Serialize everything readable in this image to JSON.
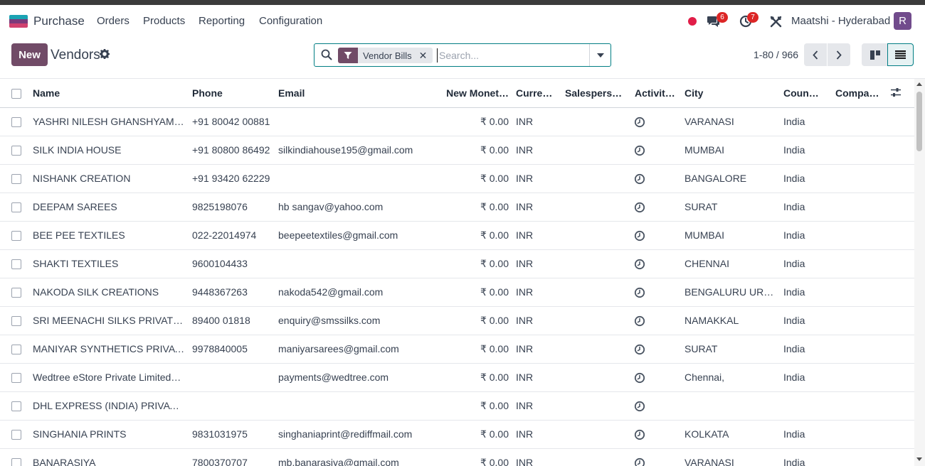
{
  "navbar": {
    "app_name": "Purchase",
    "menu": [
      "Orders",
      "Products",
      "Reporting",
      "Configuration"
    ],
    "messages_count": "6",
    "activities_count": "7",
    "company": "Maatshi - Hyderabad",
    "avatar_letter": "R"
  },
  "control_panel": {
    "new_label": "New",
    "title": "Vendors",
    "facet_label": "Vendor Bills",
    "search_placeholder": "Search...",
    "pager": "1-80 / 966"
  },
  "table": {
    "columns": [
      "Name",
      "Phone",
      "Email",
      "New Monet…",
      "Currency",
      "Salespers…",
      "Activiti…",
      "City",
      "Coun…",
      "Compa…"
    ],
    "rows": [
      {
        "name": "YASHRI NILESH GHANSHYAM SI…",
        "phone": "+91 80042 00881",
        "email": "",
        "amount": "₹ 0.00",
        "currency": "INR",
        "city": "VARANASI",
        "country": "India"
      },
      {
        "name": "SILK INDIA HOUSE",
        "phone": "+91 80800 86492",
        "email": "silkindiahouse195@gmail.com",
        "amount": "₹ 0.00",
        "currency": "INR",
        "city": "MUMBAI",
        "country": "India"
      },
      {
        "name": "NISHANK CREATION",
        "phone": "+91 93420 62229",
        "email": "",
        "amount": "₹ 0.00",
        "currency": "INR",
        "city": "BANGALORE",
        "country": "India"
      },
      {
        "name": "DEEPAM SAREES",
        "phone": "9825198076",
        "email": "hb sangav@yahoo.com",
        "amount": "₹ 0.00",
        "currency": "INR",
        "city": "SURAT",
        "country": "India"
      },
      {
        "name": "BEE PEE TEXTILES",
        "phone": "022-22014974",
        "email": "beepeetextiles@gmail.com",
        "amount": "₹ 0.00",
        "currency": "INR",
        "city": "MUMBAI",
        "country": "India"
      },
      {
        "name": "SHAKTI TEXTILES",
        "phone": "9600104433",
        "email": "",
        "amount": "₹ 0.00",
        "currency": "INR",
        "city": "CHENNAI",
        "country": "India"
      },
      {
        "name": "NAKODA SILK CREATIONS",
        "phone": "9448367263",
        "email": "nakoda542@gmail.com",
        "amount": "₹ 0.00",
        "currency": "INR",
        "city": "BENGALURU URB…",
        "country": "India"
      },
      {
        "name": "SRI MEENACHI SILKS PRIVATE LI…",
        "phone": "89400 01818",
        "email": "enquiry@smssilks.com",
        "amount": "₹ 0.00",
        "currency": "INR",
        "city": "NAMAKKAL",
        "country": "India"
      },
      {
        "name": "MANIYAR SYNTHETICS PRIVATE…",
        "phone": "9978840005",
        "email": "maniyarsarees@gmail.com",
        "amount": "₹ 0.00",
        "currency": "INR",
        "city": "SURAT",
        "country": "India"
      },
      {
        "name": "Wedtree eStore Private Limited…",
        "phone": "",
        "email": "payments@wedtree.com",
        "amount": "₹ 0.00",
        "currency": "INR",
        "city": "Chennai,",
        "country": "India"
      },
      {
        "name": "DHL EXPRESS (INDIA) PRIVATE …",
        "phone": "",
        "email": "",
        "amount": "₹ 0.00",
        "currency": "INR",
        "city": "",
        "country": ""
      },
      {
        "name": "SINGHANIA PRINTS",
        "phone": "9831031975",
        "email": "singhaniaprint@rediffmail.com",
        "amount": "₹ 0.00",
        "currency": "INR",
        "city": "KOLKATA",
        "country": "India"
      },
      {
        "name": "BANARASIYA",
        "phone": "7800370707",
        "email": "mb.banarasiya@gmail.com",
        "amount": "₹ 0.00",
        "currency": "INR",
        "city": "VARANASI",
        "country": "India"
      }
    ]
  },
  "colors": {
    "brand": "#714b67",
    "accent": "#017e84",
    "badge": "#dc2626"
  }
}
